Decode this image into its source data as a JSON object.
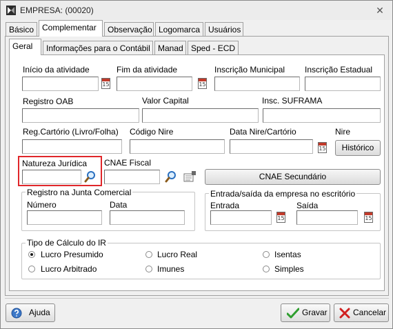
{
  "window": {
    "title": "EMPRESA: (00020)"
  },
  "tabs_top": [
    "Básico",
    "Complementar",
    "Observação",
    "Logomarca",
    "Usuários"
  ],
  "tabs_sub": [
    "Geral",
    "Informações para o Contábil",
    "Manad",
    "Sped - ECD"
  ],
  "fields": {
    "inicio_atividade": {
      "label": "Início da atividade",
      "value": ""
    },
    "fim_atividade": {
      "label": "Fim da atividade",
      "value": ""
    },
    "inscricao_municipal": {
      "label": "Inscrição Municipal",
      "value": ""
    },
    "inscricao_estadual": {
      "label": "Inscrição Estadual",
      "value": ""
    },
    "registro_oab": {
      "label": "Registro OAB",
      "value": ""
    },
    "valor_capital": {
      "label": "Valor Capital",
      "value": ""
    },
    "insc_suframa": {
      "label": "Insc. SUFRAMA",
      "value": ""
    },
    "reg_cartorio": {
      "label": "Reg.Cartório (Livro/Folha)",
      "value": ""
    },
    "codigo_nire": {
      "label": "Código Nire",
      "value": ""
    },
    "data_nire": {
      "label": "Data Nire/Cartório",
      "value": ""
    },
    "nire": {
      "label": "Nire"
    },
    "natureza_juridica": {
      "label": "Natureza Jurídica",
      "value": ""
    },
    "cnae_fiscal": {
      "label": "CNAE Fiscal",
      "value": ""
    }
  },
  "buttons": {
    "historico": "Histórico",
    "cnae_secundario": "CNAE Secundário",
    "ajuda": "Ajuda",
    "gravar": "Gravar",
    "cancelar": "Cancelar"
  },
  "registro_junta": {
    "title": "Registro na Junta Comercial",
    "numero_label": "Número",
    "data_label": "Data"
  },
  "entrada_saida": {
    "title": "Entrada/saída da empresa no escritório",
    "entrada_label": "Entrada",
    "saida_label": "Saída"
  },
  "calculo_ir": {
    "title": "Tipo de Cálculo do IR",
    "options": [
      "Lucro Presumido",
      "Lucro Real",
      "Isentas",
      "Lucro Arbitrado",
      "Imunes",
      "Simples"
    ],
    "selected": "Lucro Presumido"
  },
  "calendar_icon_text": "15",
  "colors": {
    "highlight": "#e0262a",
    "accent_check": "#2e9e2e",
    "accent_cancel": "#d02020"
  }
}
